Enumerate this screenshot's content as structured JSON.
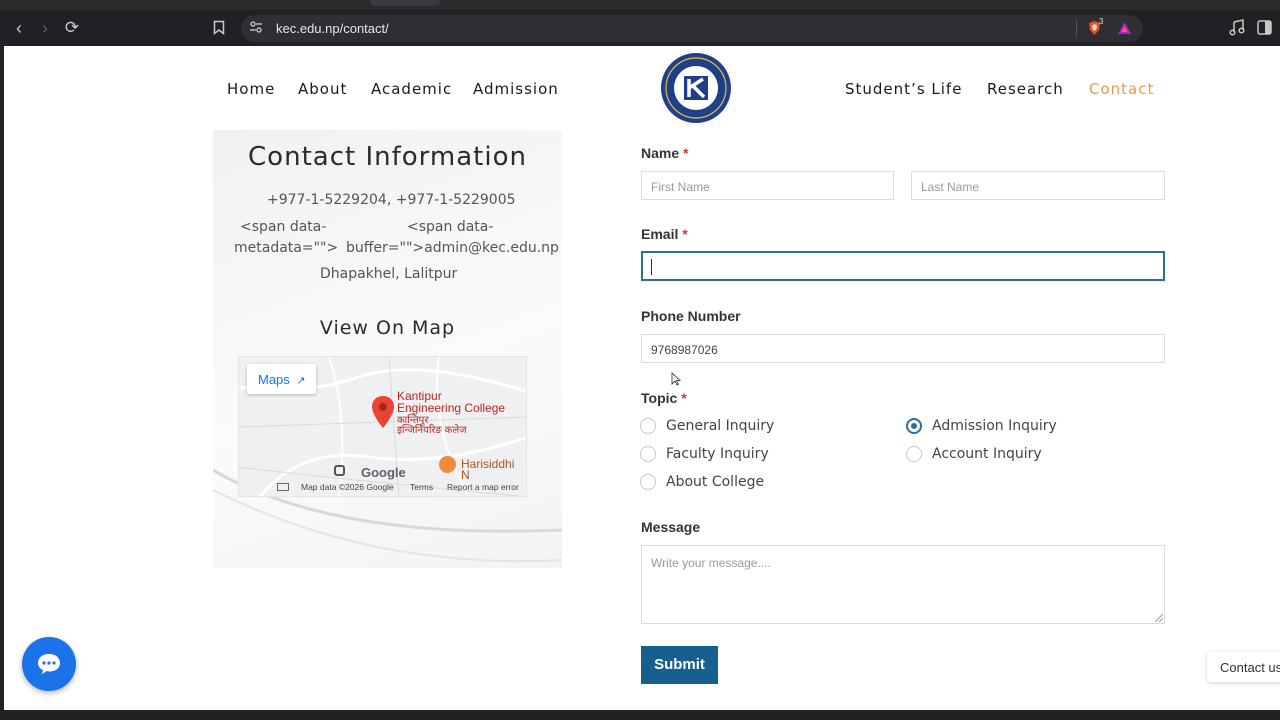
{
  "browser": {
    "url": "kec.edu.np/contact/",
    "brave_badge": "3"
  },
  "nav": {
    "left": [
      "Home",
      "About",
      "Academic",
      "Admission"
    ],
    "right": [
      "Student’s Life",
      "Research",
      "Contact"
    ],
    "active": "Contact",
    "logo_text": "Kantipur Engineering College Kathmandu 1998"
  },
  "contact_info": {
    "title": "Contact Information",
    "phone": "+977-1-5229204, +977-1-5229005",
    "email_line1_left": "<span data-",
    "email_line2_left": "metadata=\"\">",
    "email_line1_right": "<span data-",
    "email_line2_right": "buffer=\"\">admin@kec.edu.np",
    "address": "Dhapakhel, Lalitpur",
    "map_title": "View On Map"
  },
  "map": {
    "maps_button": "Maps",
    "place_en_1": "Kantipur",
    "place_en_2": "Engineering College",
    "place_np_1": "कान्तिपुर",
    "place_np_2": "इन्जिनियरिङ कलेज",
    "poi": "Harisiddhi N",
    "google": "Google",
    "attribution": "Map data ©2026 Google",
    "terms": "Terms",
    "report": "Report a map error"
  },
  "form": {
    "name_label": "Name",
    "first_placeholder": "First Name",
    "last_placeholder": "Last Name",
    "email_label": "Email",
    "phone_label": "Phone Number",
    "phone_value": "9768987026",
    "topic_label": "Topic",
    "topics": [
      "General Inquiry",
      "Admission Inquiry",
      "Faculty Inquiry",
      "Account Inquiry",
      "About College"
    ],
    "topic_selected": "Admission Inquiry",
    "required_mark": "*",
    "message_label": "Message",
    "message_placeholder": "Write your message....",
    "submit": "Submit"
  },
  "widgets": {
    "contact_tab": "Contact us"
  },
  "colors": {
    "accent": "#e39a4f",
    "primary": "#15608f",
    "focus": "#2a6f97",
    "chat": "#1a73e8"
  }
}
